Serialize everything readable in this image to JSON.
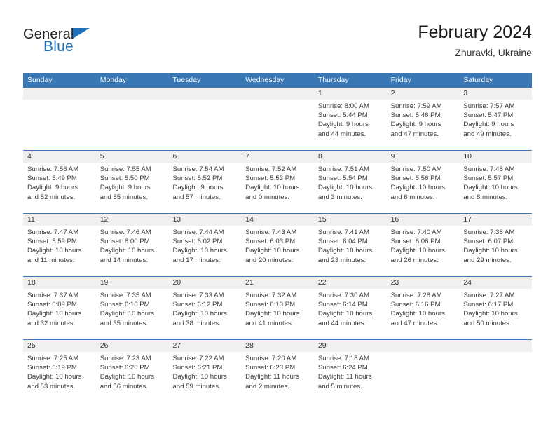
{
  "brand": {
    "name_top": "General",
    "name_bottom": "Blue",
    "triangle_icon": "triangle-icon",
    "accent_color": "#1d71b8"
  },
  "header": {
    "title": "February 2024",
    "subtitle": "Zhuravki, Ukraine"
  },
  "theme": {
    "header_blue": "#3a77b5",
    "number_band": "#f0f0f0",
    "text": "#3b3b3b"
  },
  "calendar": {
    "weekday_headers": [
      "Sunday",
      "Monday",
      "Tuesday",
      "Wednesday",
      "Thursday",
      "Friday",
      "Saturday"
    ],
    "weeks": [
      [
        {
          "day": "",
          "lines": [
            "",
            "",
            "",
            ""
          ],
          "empty": true
        },
        {
          "day": "",
          "lines": [
            "",
            "",
            "",
            ""
          ],
          "empty": true
        },
        {
          "day": "",
          "lines": [
            "",
            "",
            "",
            ""
          ],
          "empty": true
        },
        {
          "day": "",
          "lines": [
            "",
            "",
            "",
            ""
          ],
          "empty": true
        },
        {
          "day": "1",
          "lines": [
            "Sunrise: 8:00 AM",
            "Sunset: 5:44 PM",
            "Daylight: 9 hours",
            "and 44 minutes."
          ],
          "empty": false
        },
        {
          "day": "2",
          "lines": [
            "Sunrise: 7:59 AM",
            "Sunset: 5:46 PM",
            "Daylight: 9 hours",
            "and 47 minutes."
          ],
          "empty": false
        },
        {
          "day": "3",
          "lines": [
            "Sunrise: 7:57 AM",
            "Sunset: 5:47 PM",
            "Daylight: 9 hours",
            "and 49 minutes."
          ],
          "empty": false
        }
      ],
      [
        {
          "day": "4",
          "lines": [
            "Sunrise: 7:56 AM",
            "Sunset: 5:49 PM",
            "Daylight: 9 hours",
            "and 52 minutes."
          ],
          "empty": false
        },
        {
          "day": "5",
          "lines": [
            "Sunrise: 7:55 AM",
            "Sunset: 5:50 PM",
            "Daylight: 9 hours",
            "and 55 minutes."
          ],
          "empty": false
        },
        {
          "day": "6",
          "lines": [
            "Sunrise: 7:54 AM",
            "Sunset: 5:52 PM",
            "Daylight: 9 hours",
            "and 57 minutes."
          ],
          "empty": false
        },
        {
          "day": "7",
          "lines": [
            "Sunrise: 7:52 AM",
            "Sunset: 5:53 PM",
            "Daylight: 10 hours",
            "and 0 minutes."
          ],
          "empty": false
        },
        {
          "day": "8",
          "lines": [
            "Sunrise: 7:51 AM",
            "Sunset: 5:54 PM",
            "Daylight: 10 hours",
            "and 3 minutes."
          ],
          "empty": false
        },
        {
          "day": "9",
          "lines": [
            "Sunrise: 7:50 AM",
            "Sunset: 5:56 PM",
            "Daylight: 10 hours",
            "and 6 minutes."
          ],
          "empty": false
        },
        {
          "day": "10",
          "lines": [
            "Sunrise: 7:48 AM",
            "Sunset: 5:57 PM",
            "Daylight: 10 hours",
            "and 8 minutes."
          ],
          "empty": false
        }
      ],
      [
        {
          "day": "11",
          "lines": [
            "Sunrise: 7:47 AM",
            "Sunset: 5:59 PM",
            "Daylight: 10 hours",
            "and 11 minutes."
          ],
          "empty": false
        },
        {
          "day": "12",
          "lines": [
            "Sunrise: 7:46 AM",
            "Sunset: 6:00 PM",
            "Daylight: 10 hours",
            "and 14 minutes."
          ],
          "empty": false
        },
        {
          "day": "13",
          "lines": [
            "Sunrise: 7:44 AM",
            "Sunset: 6:02 PM",
            "Daylight: 10 hours",
            "and 17 minutes."
          ],
          "empty": false
        },
        {
          "day": "14",
          "lines": [
            "Sunrise: 7:43 AM",
            "Sunset: 6:03 PM",
            "Daylight: 10 hours",
            "and 20 minutes."
          ],
          "empty": false
        },
        {
          "day": "15",
          "lines": [
            "Sunrise: 7:41 AM",
            "Sunset: 6:04 PM",
            "Daylight: 10 hours",
            "and 23 minutes."
          ],
          "empty": false
        },
        {
          "day": "16",
          "lines": [
            "Sunrise: 7:40 AM",
            "Sunset: 6:06 PM",
            "Daylight: 10 hours",
            "and 26 minutes."
          ],
          "empty": false
        },
        {
          "day": "17",
          "lines": [
            "Sunrise: 7:38 AM",
            "Sunset: 6:07 PM",
            "Daylight: 10 hours",
            "and 29 minutes."
          ],
          "empty": false
        }
      ],
      [
        {
          "day": "18",
          "lines": [
            "Sunrise: 7:37 AM",
            "Sunset: 6:09 PM",
            "Daylight: 10 hours",
            "and 32 minutes."
          ],
          "empty": false
        },
        {
          "day": "19",
          "lines": [
            "Sunrise: 7:35 AM",
            "Sunset: 6:10 PM",
            "Daylight: 10 hours",
            "and 35 minutes."
          ],
          "empty": false
        },
        {
          "day": "20",
          "lines": [
            "Sunrise: 7:33 AM",
            "Sunset: 6:12 PM",
            "Daylight: 10 hours",
            "and 38 minutes."
          ],
          "empty": false
        },
        {
          "day": "21",
          "lines": [
            "Sunrise: 7:32 AM",
            "Sunset: 6:13 PM",
            "Daylight: 10 hours",
            "and 41 minutes."
          ],
          "empty": false
        },
        {
          "day": "22",
          "lines": [
            "Sunrise: 7:30 AM",
            "Sunset: 6:14 PM",
            "Daylight: 10 hours",
            "and 44 minutes."
          ],
          "empty": false
        },
        {
          "day": "23",
          "lines": [
            "Sunrise: 7:28 AM",
            "Sunset: 6:16 PM",
            "Daylight: 10 hours",
            "and 47 minutes."
          ],
          "empty": false
        },
        {
          "day": "24",
          "lines": [
            "Sunrise: 7:27 AM",
            "Sunset: 6:17 PM",
            "Daylight: 10 hours",
            "and 50 minutes."
          ],
          "empty": false
        }
      ],
      [
        {
          "day": "25",
          "lines": [
            "Sunrise: 7:25 AM",
            "Sunset: 6:19 PM",
            "Daylight: 10 hours",
            "and 53 minutes."
          ],
          "empty": false
        },
        {
          "day": "26",
          "lines": [
            "Sunrise: 7:23 AM",
            "Sunset: 6:20 PM",
            "Daylight: 10 hours",
            "and 56 minutes."
          ],
          "empty": false
        },
        {
          "day": "27",
          "lines": [
            "Sunrise: 7:22 AM",
            "Sunset: 6:21 PM",
            "Daylight: 10 hours",
            "and 59 minutes."
          ],
          "empty": false
        },
        {
          "day": "28",
          "lines": [
            "Sunrise: 7:20 AM",
            "Sunset: 6:23 PM",
            "Daylight: 11 hours",
            "and 2 minutes."
          ],
          "empty": false
        },
        {
          "day": "29",
          "lines": [
            "Sunrise: 7:18 AM",
            "Sunset: 6:24 PM",
            "Daylight: 11 hours",
            "and 5 minutes."
          ],
          "empty": false
        },
        {
          "day": "",
          "lines": [
            "",
            "",
            "",
            ""
          ],
          "empty": true
        },
        {
          "day": "",
          "lines": [
            "",
            "",
            "",
            ""
          ],
          "empty": true
        }
      ]
    ]
  }
}
